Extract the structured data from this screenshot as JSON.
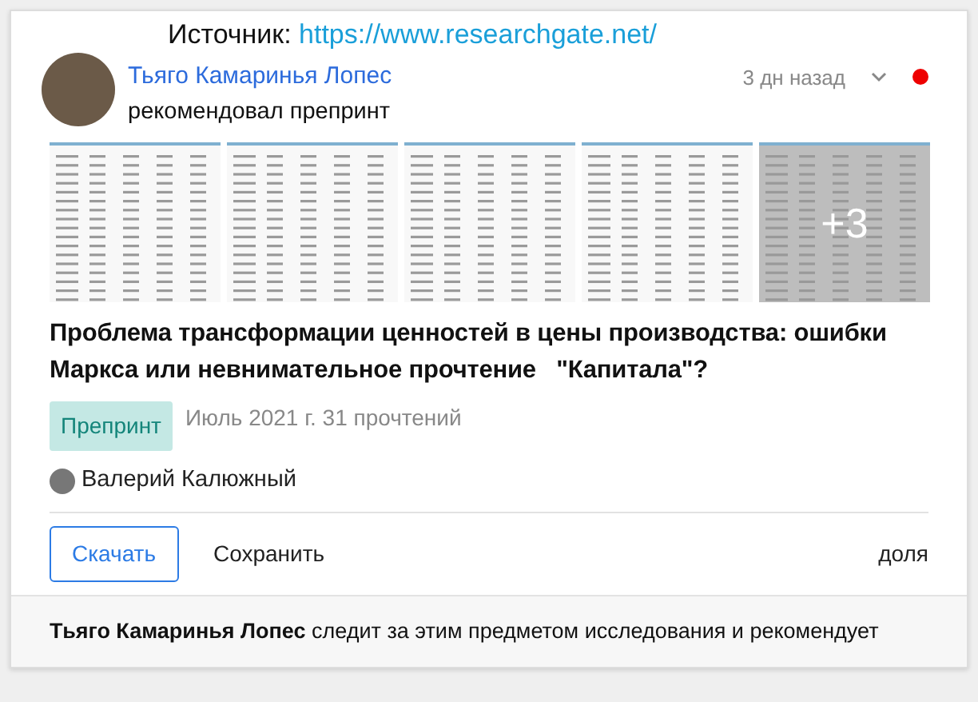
{
  "source": {
    "label": "Источник:",
    "url": "https://www.researchgate.net/"
  },
  "post": {
    "author": "Тьяго Камаринья Лопес",
    "action": "рекомендовал препринт",
    "time": "3 дн назад",
    "unread": true
  },
  "previews": [
    {
      "dimmed": false
    },
    {
      "dimmed": false
    },
    {
      "dimmed": false
    },
    {
      "dimmed": false
    },
    {
      "dimmed": true,
      "more": "+3"
    }
  ],
  "publication": {
    "title": "Проблема трансформации ценностей в цены производства: ошибки Маркса или невнимательное прочтение   \"Капитала\"?",
    "type": "Препринт",
    "meta": "Июль 2021 г. 31 прочтений",
    "authors": [
      "Валерий Калюжный"
    ]
  },
  "actions": [
    {
      "label": "Скачать",
      "kind": "primary"
    },
    {
      "label": "Сохранить",
      "kind": "plain"
    },
    {
      "label": "доля",
      "kind": "right"
    }
  ],
  "footer": "**Тьяго Камаринья Лопес** следит за этим предметом исследования и рекомендует"
}
